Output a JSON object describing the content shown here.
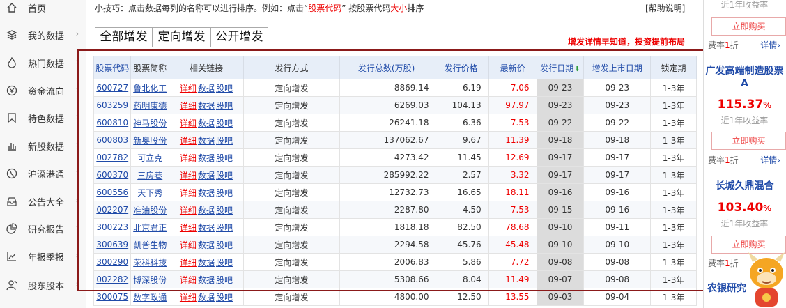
{
  "sidebar": {
    "items": [
      {
        "label": "首页",
        "icon": "home-icon",
        "arrow": ""
      },
      {
        "label": "我的数据",
        "icon": "layers-icon",
        "arrow": "›"
      },
      {
        "label": "热门数据",
        "icon": "flame-icon",
        "arrow": "›"
      },
      {
        "label": "资金流向",
        "icon": "yen-circle-icon",
        "arrow": "›"
      },
      {
        "label": "特色数据",
        "icon": "bookmark-icon",
        "arrow": "›"
      },
      {
        "label": "新股数据",
        "icon": "bar-chart-icon",
        "arrow": "›"
      },
      {
        "label": "沪深港通",
        "icon": "globe-icon",
        "arrow": "›"
      },
      {
        "label": "公告大全",
        "icon": "inbox-icon",
        "arrow": "›"
      },
      {
        "label": "研究报告",
        "icon": "pie-chart-icon",
        "arrow": "›"
      },
      {
        "label": "年报季报",
        "icon": "line-chart-icon",
        "arrow": "›"
      },
      {
        "label": "股东股本",
        "icon": "user-icon",
        "arrow": "›"
      }
    ]
  },
  "tip": {
    "prefix": "小技巧：点击数据每列的名称可以进行排序。例如：点击",
    "quote_open": "“",
    "highlight1": "股票代码",
    "quote_close": "”",
    "middle": " 按股票代码",
    "highlight2": "大小",
    "suffix": "排序"
  },
  "help_link": "[帮助说明]",
  "tabs": [
    {
      "label": "全部增发",
      "active": false
    },
    {
      "label": "定向增发",
      "active": true
    },
    {
      "label": "公开增发",
      "active": false
    }
  ],
  "promo": "增发详情早知道，投资提前布局",
  "table": {
    "headers": [
      "股票代码",
      "股票简称",
      "相关链接",
      "发行方式",
      "发行总数(万股)",
      "发行价格",
      "最新价",
      "发行日期",
      "增发上市日期",
      "锁定期"
    ],
    "sort_arrow": "⬇",
    "link_labels": [
      "详细",
      "数据",
      "股吧"
    ],
    "rows": [
      {
        "code": "600727",
        "name": "鲁北化工",
        "method": "定向增发",
        "total": "8869.14",
        "price": "6.19",
        "latest": "7.06",
        "date": "09-23",
        "listing": "09-23",
        "lock": "1-3年"
      },
      {
        "code": "603259",
        "name": "药明康德",
        "method": "定向增发",
        "total": "6269.03",
        "price": "104.13",
        "latest": "97.97",
        "date": "09-23",
        "listing": "09-23",
        "lock": "1-3年"
      },
      {
        "code": "600810",
        "name": "神马股份",
        "method": "定向增发",
        "total": "26241.18",
        "price": "6.36",
        "latest": "7.53",
        "date": "09-22",
        "listing": "09-22",
        "lock": "1-3年"
      },
      {
        "code": "600803",
        "name": "新奥股份",
        "method": "定向增发",
        "total": "137062.67",
        "price": "9.67",
        "latest": "11.39",
        "date": "09-18",
        "listing": "09-18",
        "lock": "1-3年"
      },
      {
        "code": "002782",
        "name": "可立克",
        "method": "定向增发",
        "total": "4273.42",
        "price": "11.45",
        "latest": "12.69",
        "date": "09-17",
        "listing": "09-17",
        "lock": "1-3年"
      },
      {
        "code": "600370",
        "name": "三房巷",
        "method": "定向增发",
        "total": "285992.22",
        "price": "2.57",
        "latest": "3.32",
        "date": "09-17",
        "listing": "09-17",
        "lock": "1-3年"
      },
      {
        "code": "600556",
        "name": "天下秀",
        "method": "定向增发",
        "total": "12732.73",
        "price": "16.65",
        "latest": "18.11",
        "date": "09-16",
        "listing": "09-16",
        "lock": "1-3年"
      },
      {
        "code": "002207",
        "name": "准油股份",
        "method": "定向增发",
        "total": "2287.80",
        "price": "4.50",
        "latest": "7.53",
        "date": "09-15",
        "listing": "09-16",
        "lock": "1-3年"
      },
      {
        "code": "300223",
        "name": "北京君正",
        "method": "定向增发",
        "total": "1818.18",
        "price": "82.50",
        "latest": "78.68",
        "date": "09-10",
        "listing": "09-11",
        "lock": "1-3年"
      },
      {
        "code": "300639",
        "name": "凯普生物",
        "method": "定向增发",
        "total": "2294.58",
        "price": "45.76",
        "latest": "45.48",
        "date": "09-10",
        "listing": "09-10",
        "lock": "1-3年"
      },
      {
        "code": "300290",
        "name": "荣科科技",
        "method": "定向增发",
        "total": "2006.83",
        "price": "5.86",
        "latest": "7.72",
        "date": "09-08",
        "listing": "09-08",
        "lock": "1-3年"
      },
      {
        "code": "002282",
        "name": "博深股份",
        "method": "定向增发",
        "total": "5308.66",
        "price": "8.04",
        "latest": "11.49",
        "date": "09-07",
        "listing": "09-08",
        "lock": "1-3年"
      },
      {
        "code": "300075",
        "name": "数字政通",
        "method": "定向增发",
        "total": "4800.00",
        "price": "12.50",
        "latest": "13.55",
        "date": "09-03",
        "listing": "09-04",
        "lock": "1-3年"
      }
    ]
  },
  "right_panel": {
    "top_text": "近1年收益率",
    "buy_label": "立即购买",
    "fee_prefix": "费率",
    "fee_value": "1",
    "fee_suffix": "折",
    "detail_label": "详情›",
    "funds": [
      {
        "name": "广发高端制造股票A",
        "return": "115.37",
        "return_unit": "%",
        "return_label": "近1年收益率"
      },
      {
        "name": "长城久鼎混合",
        "return": "103.40",
        "return_unit": "%",
        "return_label": "近1年收益率"
      }
    ],
    "bottom_text": "农银研究"
  },
  "colors": {
    "accent_red": "#e00000",
    "link_blue": "#1f4aa8",
    "frame": "#8b1a1a"
  }
}
